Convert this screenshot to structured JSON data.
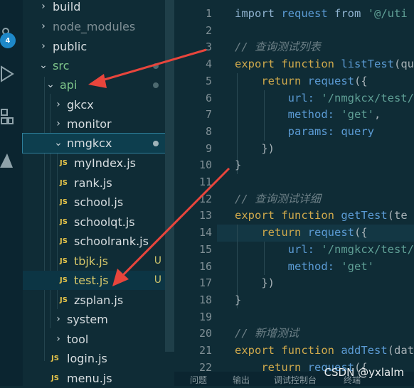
{
  "activity_bar": {
    "badge": "4",
    "icons": [
      "source-control-icon",
      "run-debug-icon",
      "extensions-icon",
      "azure-icon"
    ]
  },
  "explorer": {
    "items": [
      {
        "label": "build",
        "type": "folder",
        "collapsed": true
      },
      {
        "label": "node_modules",
        "type": "folder",
        "collapsed": true
      },
      {
        "label": "public",
        "type": "folder",
        "collapsed": true
      },
      {
        "label": "src",
        "type": "folder",
        "collapsed": false
      },
      {
        "label": "api",
        "type": "folder",
        "collapsed": false
      },
      {
        "label": "gkcx",
        "type": "folder",
        "collapsed": true
      },
      {
        "label": "monitor",
        "type": "folder",
        "collapsed": true
      },
      {
        "label": "nmgkcx",
        "type": "folder",
        "collapsed": false
      },
      {
        "label": "myIndex.js",
        "type": "file"
      },
      {
        "label": "rank.js",
        "type": "file"
      },
      {
        "label": "school.js",
        "type": "file"
      },
      {
        "label": "schoolqt.js",
        "type": "file"
      },
      {
        "label": "schoolrank.js",
        "type": "file"
      },
      {
        "label": "tbjk.js",
        "type": "file",
        "status": "U"
      },
      {
        "label": "test.js",
        "type": "file",
        "status": "U"
      },
      {
        "label": "zsplan.js",
        "type": "file"
      },
      {
        "label": "system",
        "type": "folder",
        "collapsed": true
      },
      {
        "label": "tool",
        "type": "folder",
        "collapsed": true
      },
      {
        "label": "login.js",
        "type": "file"
      },
      {
        "label": "menu.js",
        "type": "file"
      }
    ],
    "js_badge": "JS"
  },
  "editor": {
    "line_numbers": [
      "1",
      "2",
      "3",
      "4",
      "5",
      "6",
      "7",
      "8",
      "9",
      "10",
      "11",
      "12",
      "13",
      "14",
      "15",
      "16",
      "17",
      "18",
      "19",
      "20",
      "21",
      "22"
    ],
    "code": {
      "l1_import": "import",
      "l1_request": "request",
      "l1_from": "from",
      "l1_path": "'@/uti",
      "l3_comment": "// 查询测试列表",
      "l4_export": "export",
      "l4_function": "function",
      "l4_name": "listTest",
      "l4_param": "(qu",
      "l5_return": "return",
      "l5_call": "request",
      "l5_open": "({",
      "l6_key": "url:",
      "l6_val": "'/nmgkcx/test/",
      "l7_key": "method:",
      "l7_val": "'get'",
      "l7_comma": ",",
      "l8_key": "params:",
      "l8_val": "query",
      "l9_close": "})",
      "l10_close": "}",
      "l12_comment": "// 查询测试详细",
      "l13_export": "export",
      "l13_function": "function",
      "l13_name": "getTest",
      "l13_param": "(te",
      "l14_return": "return",
      "l14_call": "request",
      "l14_open": "({",
      "l15_key": "url:",
      "l15_val": "'/nmgkcx/test/",
      "l16_key": "method:",
      "l16_val": "'get'",
      "l17_close": "})",
      "l18_close": "}",
      "l20_comment": "// 新增测试",
      "l21_export": "export",
      "l21_function": "function",
      "l21_name": "addTest",
      "l21_param": "(dat",
      "l22_return": "return",
      "l22_call": "request",
      "l22_open": "({"
    }
  },
  "panel": {
    "tabs": [
      "问题",
      "输出",
      "调试控制台",
      "终端"
    ]
  },
  "watermark": "CSDN @yxlalm",
  "colors": {
    "sidebar_bg": "#0f2c36",
    "selection": "#0d3e4e",
    "arrow": "#e8453c",
    "git_untracked": "#c9c16a"
  }
}
